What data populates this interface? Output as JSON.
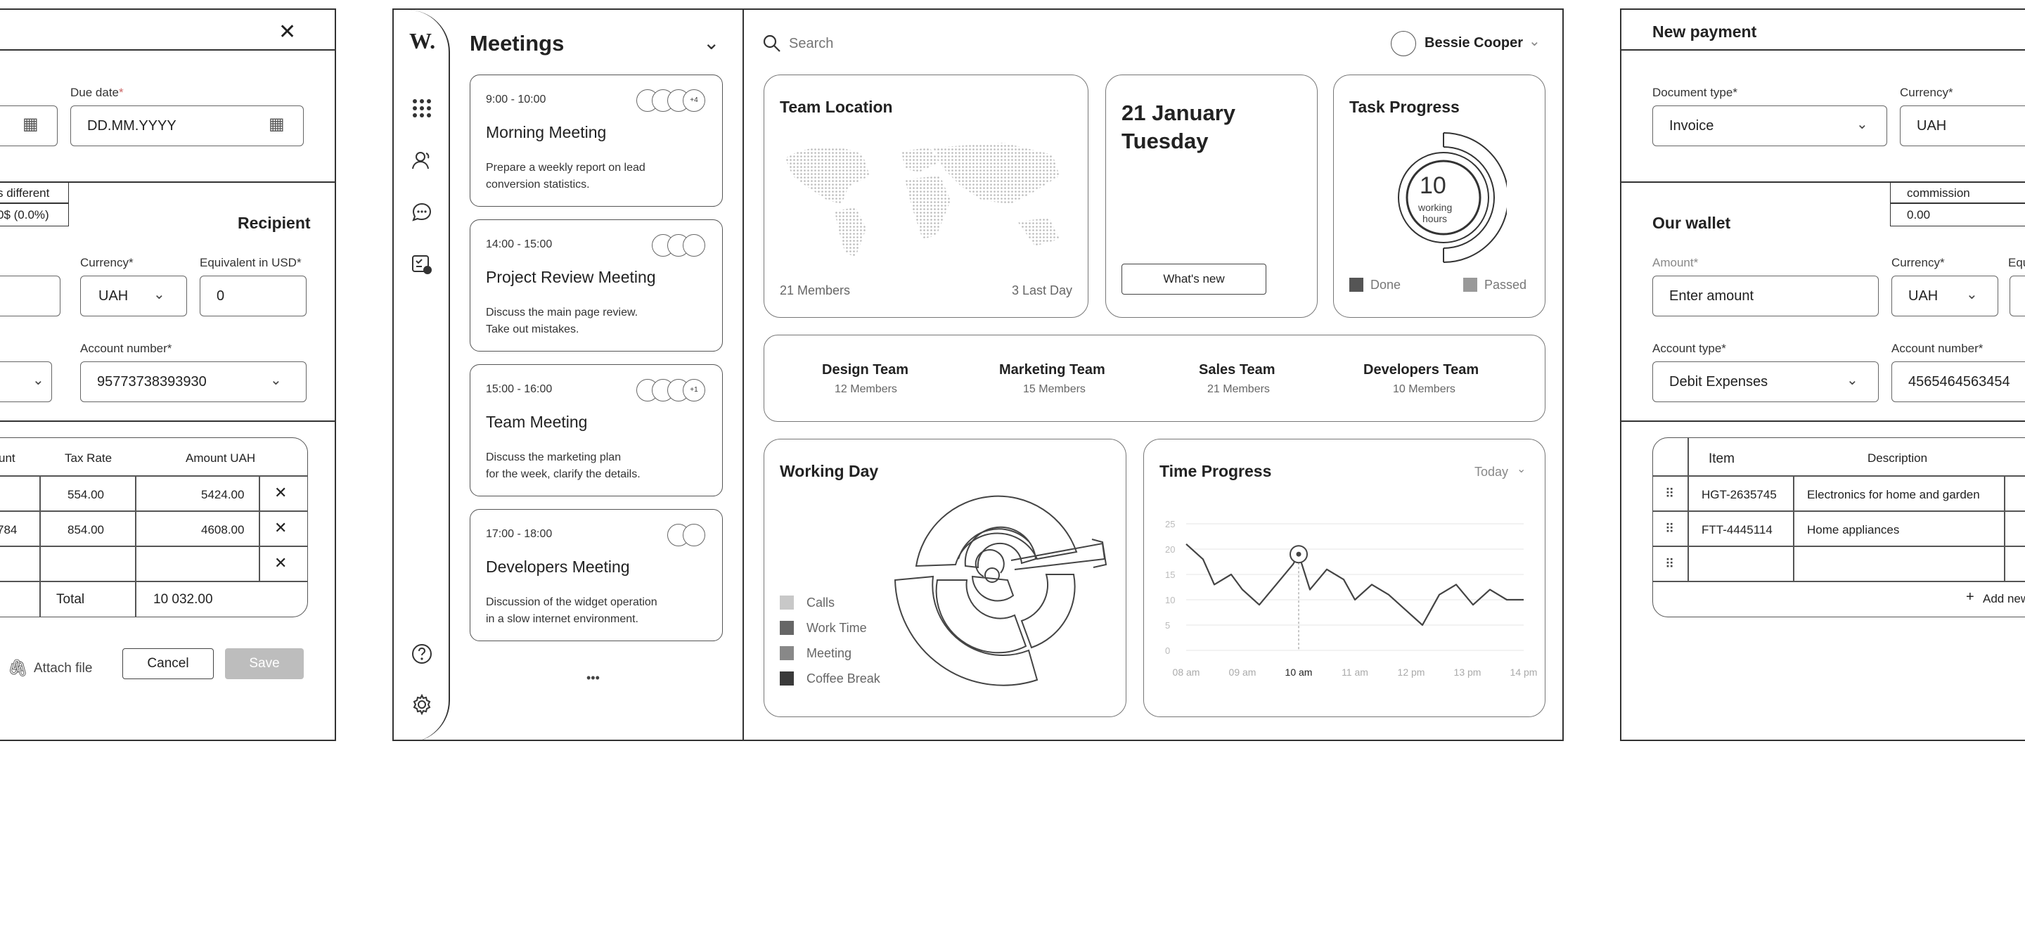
{
  "left_form": {
    "close_icon": "close-icon",
    "due_date_label": "Due date",
    "due_date_placeholder": "DD.MM.YYYY",
    "different_label": "s different",
    "different_value": "0$ (0.0%)",
    "recipient_title": "Recipient",
    "currency_label": "Currency*",
    "currency_value": "UAH",
    "equiv_label": "Equivalent in USD*",
    "equiv_value": "0",
    "account_label": "Account number*",
    "account_value": "95773738393930",
    "table_headers": [
      "unt",
      "Tax Rate",
      "Amount UAH"
    ],
    "rows": [
      {
        "c1": "",
        "tax": "554.00",
        "amount": "5424.00"
      },
      {
        "c1": "784",
        "tax": "854.00",
        "amount": "4608.00"
      },
      {
        "c1": "",
        "tax": "",
        "amount": ""
      }
    ],
    "total_label": "Total",
    "total_value": "10 032.00",
    "attach_label": "Attach file",
    "cancel_label": "Cancel",
    "save_label": "Save"
  },
  "dashboard": {
    "logo": "W.",
    "meetings_title": "Meetings",
    "meetings": [
      {
        "time": "9:00 - 10:00",
        "title": "Morning Meeting",
        "desc": "Prepare a weekly report on lead\nconversion statistics.",
        "extra": "+4"
      },
      {
        "time": "14:00 - 15:00",
        "title": "Project Review Meeting",
        "desc": "Discuss the main page review.\nTake out mistakes.",
        "extra": ""
      },
      {
        "time": "15:00 - 16:00",
        "title": "Team Meeting",
        "desc": "Discuss the marketing plan\nfor the week, clarify the details.",
        "extra": "+1"
      },
      {
        "time": "17:00 - 18:00",
        "title": "Developers Meeting",
        "desc": "Discussion of the widget operation\nin a slow internet environment.",
        "extra": ""
      }
    ],
    "more_label": "•••",
    "search_placeholder": "Search",
    "user_name": "Bessie Cooper",
    "team_location": {
      "title": "Team Location",
      "members": "21 Members",
      "last_day": "3 Last Day"
    },
    "date_card": {
      "line1": "21 January",
      "line2": "Tuesday",
      "button": "What's new"
    },
    "task_progress": {
      "title": "Task Progress",
      "value": "10",
      "unit_line1": "working",
      "unit_line2": "hours",
      "legend_done": "Done",
      "legend_passed": "Passed"
    },
    "teams": [
      {
        "name": "Design Team",
        "members": "12  Members"
      },
      {
        "name": "Marketing Team",
        "members": "15  Members"
      },
      {
        "name": "Sales Team",
        "members": "21  Members"
      },
      {
        "name": "Developers Team",
        "members": "10  Members"
      }
    ],
    "working_day": {
      "title": "Working Day",
      "legend": [
        "Calls",
        "Work Time",
        "Meeting",
        "Coffee Break"
      ]
    },
    "time_progress": {
      "title": "Time Progress",
      "filter": "Today"
    },
    "colors": {
      "calls": "#c8c8c8",
      "work_time": "#666666",
      "meeting": "#888888",
      "coffee_break": "#3a3a3a"
    }
  },
  "chart_data": {
    "type": "line",
    "title": "Time Progress",
    "x": [
      "08 am",
      "09 am",
      "10 am",
      "11 am",
      "12 pm",
      "13 pm",
      "14 pm"
    ],
    "yticks": [
      0,
      5,
      10,
      15,
      20,
      25
    ],
    "ylim": [
      0,
      25
    ],
    "series": [
      {
        "values_x": [
          0,
          0.3,
          0.5,
          0.8,
          1.0,
          1.3,
          1.6,
          1.9,
          2.0,
          2.2,
          2.5,
          2.8,
          3.0,
          3.3,
          3.6,
          3.9,
          4.2,
          4.5,
          4.8,
          5.1,
          5.4,
          5.7,
          6.0
        ],
        "values_y": [
          21,
          18,
          13,
          15,
          12,
          9,
          13,
          17,
          19,
          12,
          16,
          14,
          10,
          13,
          11,
          8,
          5,
          11,
          13,
          9,
          12,
          10,
          10
        ]
      }
    ],
    "highlight_x": "10 am",
    "grid": true
  },
  "right_form": {
    "title": "New payment",
    "doc_type_label": "Document type*",
    "doc_type_value": "Invoice",
    "currency_label": "Currency*",
    "currency_value": "UAH",
    "commission_label": "commission",
    "commission_value": "0.00",
    "wallet_title": "Our wallet",
    "amount_label": "Amount*",
    "amount_placeholder": "Enter amount",
    "currency2_label": "Currency*",
    "currency2_value": "UAH",
    "equiv_label": "Equ",
    "account_type_label": "Account type*",
    "account_type_value": "Debit Expenses",
    "account_number_label": "Account number*",
    "account_number_value": "4565464563454",
    "table_headers": [
      "Item",
      "Description"
    ],
    "rows": [
      {
        "item": "HGT-2635745",
        "desc": "Electronics for home and garden"
      },
      {
        "item": "FTT-4445114",
        "desc": "Home appliances"
      },
      {
        "item": "",
        "desc": ""
      }
    ],
    "add_label": "Add new"
  }
}
